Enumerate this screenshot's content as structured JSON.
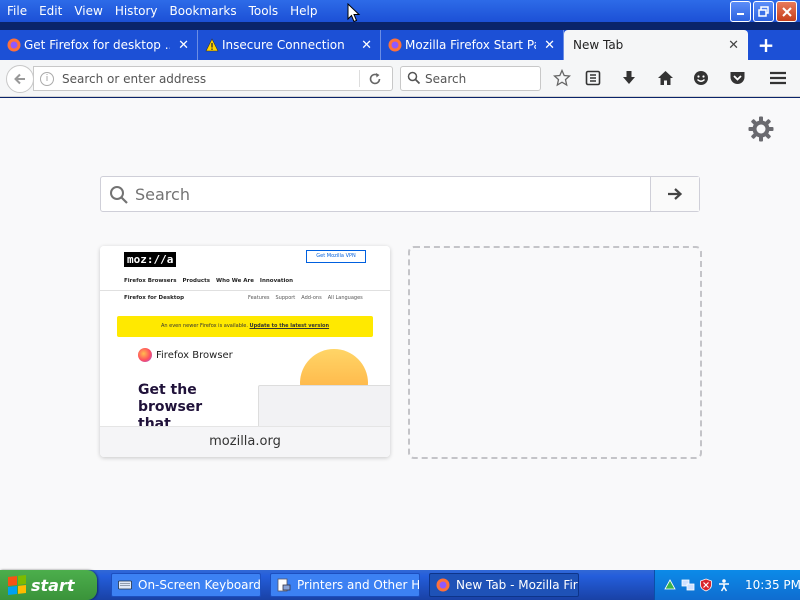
{
  "menu": [
    "File",
    "Edit",
    "View",
    "History",
    "Bookmarks",
    "Tools",
    "Help"
  ],
  "tabs": [
    {
      "label": "Get Firefox for desktop ...",
      "icon": "firefox-icon"
    },
    {
      "label": "Insecure Connection",
      "icon": "warning-icon"
    },
    {
      "label": "Mozilla Firefox Start Page",
      "icon": "firefox-icon"
    },
    {
      "label": "New Tab",
      "icon": "none"
    }
  ],
  "active_tab_index": 3,
  "urlbar": {
    "placeholder": "Search or enter address"
  },
  "searchbar": {
    "placeholder": "Search"
  },
  "content": {
    "search_placeholder": "Search",
    "tile": {
      "caption": "mozilla.org",
      "preview": {
        "logo": "moz://a",
        "vpn_button": "Get Mozilla VPN",
        "nav": [
          "Firefox Browsers",
          "Products",
          "Who We Are",
          "Innovation"
        ],
        "subtitle": "Firefox for Desktop",
        "subnav": [
          "Features",
          "Support",
          "Add-ons",
          "All Languages"
        ],
        "banner_text": "An even newer Firefox is available.",
        "banner_link": "Update to the latest version",
        "brand": "Firefox Browser",
        "headline": "Get the browser that"
      }
    }
  },
  "taskbar": {
    "start_label": "start",
    "items": [
      {
        "label": "On-Screen Keyboard",
        "icon": "keyboard-icon"
      },
      {
        "label": "Printers and Other H...",
        "icon": "printers-icon"
      },
      {
        "label": "New Tab - Mozilla Fire...",
        "icon": "firefox-icon"
      }
    ],
    "clock": "10:35 PM"
  },
  "colors": {
    "titlebar": "#1c50d6",
    "content_bg": "#f9f9fa",
    "taskbar": "#245edb",
    "start_button": "#3a933a",
    "tray": "#0f6dd0"
  }
}
